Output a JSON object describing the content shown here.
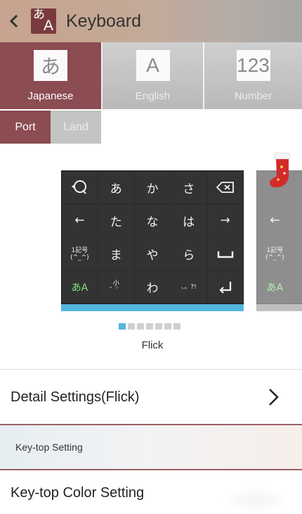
{
  "header": {
    "title": "Keyboard",
    "app_icon": {
      "top_char": "あ",
      "bottom_char": "A"
    }
  },
  "mode_tabs": [
    {
      "glyph": "あ",
      "label": "Japanese",
      "active": true
    },
    {
      "glyph": "A",
      "label": "English",
      "active": false
    },
    {
      "glyph": "123",
      "label": "Number",
      "active": false
    }
  ],
  "orientation_tabs": [
    {
      "label": "Port",
      "active": true
    },
    {
      "label": "Land",
      "active": false
    }
  ],
  "keyboard_preview": {
    "name": "Flick",
    "page_count": 7,
    "active_page": 1,
    "keys": [
      [
        "search-icon",
        "あ",
        "か",
        "さ",
        "backspace-icon"
      ],
      [
        "←",
        "た",
        "な",
        "は",
        "→"
      ],
      [
        "1記号\n(^_^)",
        "ま",
        "や",
        "ら",
        "space-icon"
      ],
      [
        "あA",
        "小\n゛゜",
        "わ",
        "、。?!",
        "enter-icon"
      ]
    ]
  },
  "settings": {
    "detail_label": "Detail Settings(Flick)",
    "section_label": "Key-top Setting",
    "color_label": "Key-top Color Setting"
  },
  "colors": {
    "accent": "#8b4c52",
    "indicator": "#52b6de",
    "keyboard_bg": "#333333"
  }
}
